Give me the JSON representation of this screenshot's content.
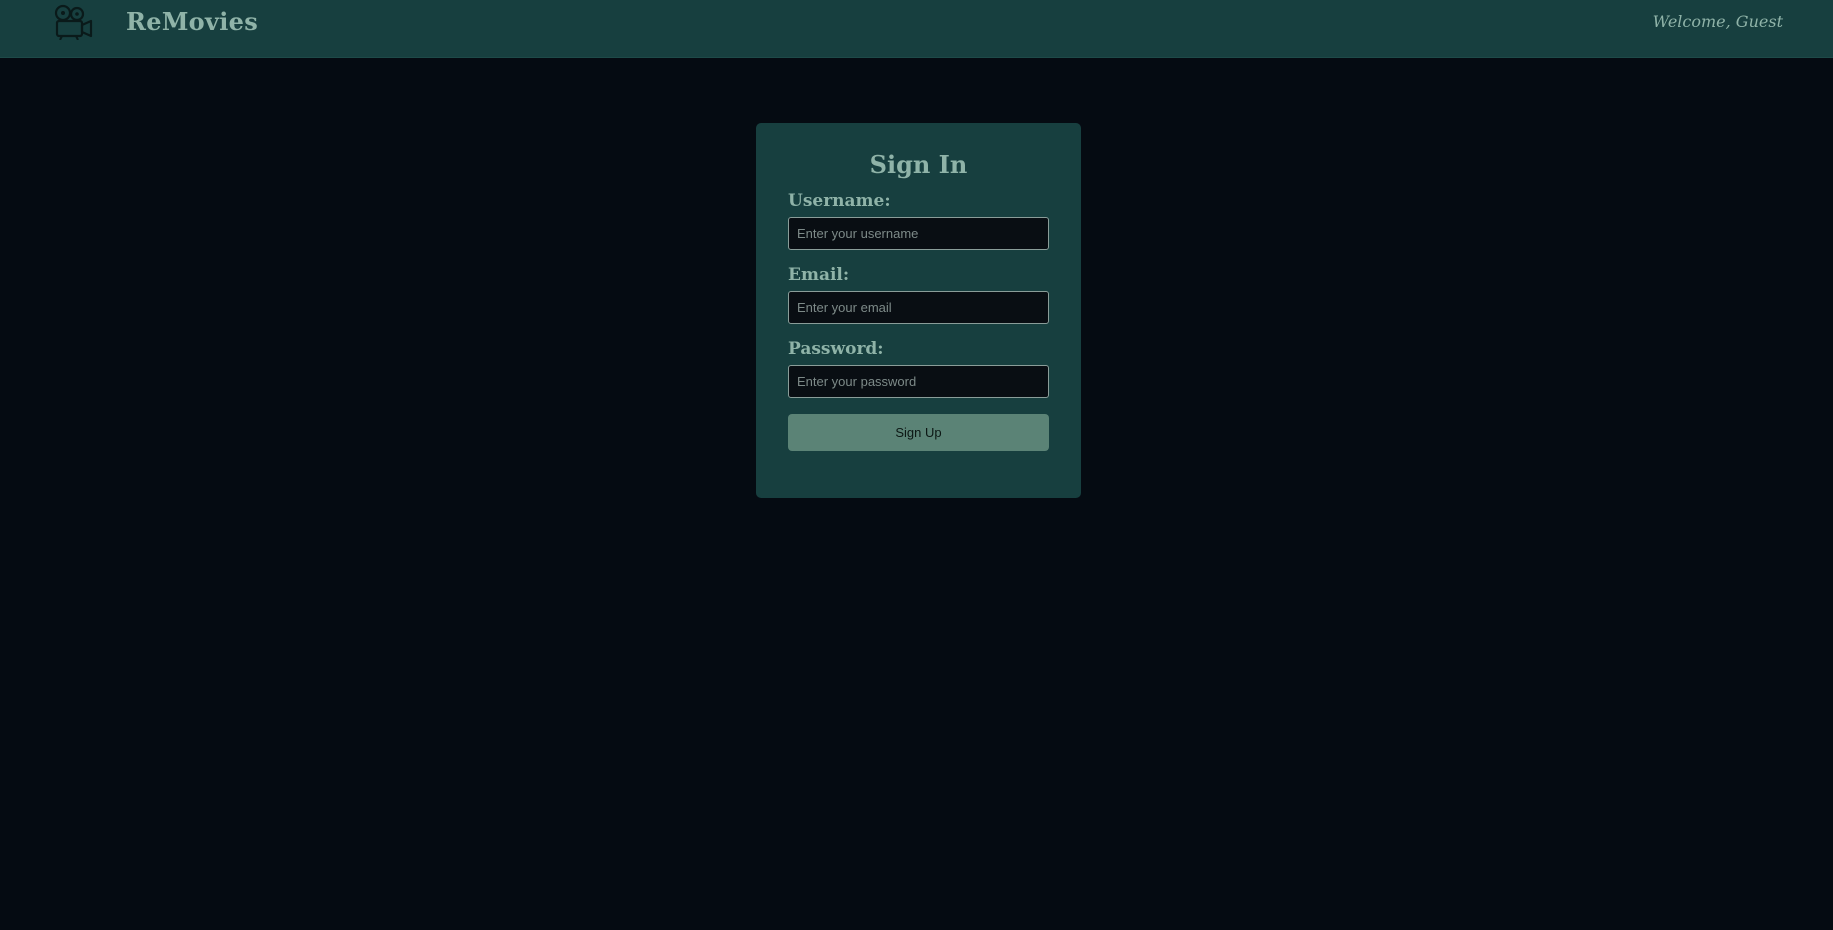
{
  "header": {
    "brand": "ReMovies",
    "logo_icon": "movie-camera-icon",
    "welcome": "Welcome, Guest"
  },
  "form": {
    "title": "Sign In",
    "fields": [
      {
        "label": "Username:",
        "placeholder": "Enter your username",
        "value": ""
      },
      {
        "label": "Email:",
        "placeholder": "Enter your email",
        "value": ""
      },
      {
        "label": "Password:",
        "placeholder": "Enter your password",
        "value": ""
      }
    ],
    "submit_label": "Sign Up"
  },
  "colors": {
    "header_bg": "#173f3f",
    "page_bg": "#050b12",
    "card_bg": "#173f3f",
    "accent_text": "#8fb3a8",
    "button_bg": "#5b8376"
  }
}
